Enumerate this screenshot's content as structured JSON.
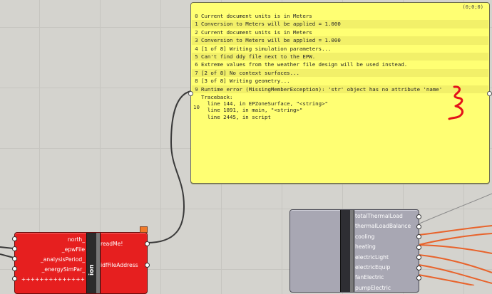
{
  "panel": {
    "coordinate": "(0;0;0)",
    "lines": [
      {
        "num": "0",
        "text": "Current document units is in Meters"
      },
      {
        "num": "1",
        "text": "Conversion to Meters will be applied = 1.000"
      },
      {
        "num": "2",
        "text": "Current document units is in Meters"
      },
      {
        "num": "3",
        "text": "Conversion to Meters will be applied = 1.000"
      },
      {
        "num": "4",
        "text": "[1 of 8] Writing simulation parameters..."
      },
      {
        "num": "5",
        "text": "Can't find ddy file next to the EPW."
      },
      {
        "num": "6",
        "text": "Extreme values from the weather file design will be used instead."
      },
      {
        "num": "7",
        "text": "[2 of 8] No context surfaces..."
      },
      {
        "num": "8",
        "text": "[3 of 8] Writing geometry..."
      },
      {
        "num": "9",
        "text": "Runtime error (MissingMemberException): 'str' object has no attribute 'name'"
      }
    ],
    "traceback": {
      "num": "10",
      "lines": [
        "Traceback:",
        "  line 144, in EPZoneSurface, \"<string>\"",
        "  line 1891, in main, \"<string>\"",
        "  line 2445, in script"
      ]
    }
  },
  "red_component": {
    "inputs": [
      "north_",
      "_epwFile",
      "_analysisPeriod_",
      "_energySimPar_",
      "++++++++++++++"
    ],
    "outputs": [
      "readMe!",
      "idfFileAddress"
    ],
    "vertical_label": "ion"
  },
  "gray_component": {
    "outputs": [
      "totalThermalLoad",
      "thermalLoadBalance",
      "cooling",
      "heating",
      "electricLight",
      "electricEquip",
      "fanElectric",
      "pumpElectric"
    ]
  },
  "colors": {
    "panel_bg": "#ffff73",
    "red_component": "#e61f1f",
    "gray_component": "#a8a7b3",
    "wire_orange": "#e8632b",
    "scribble_red": "#e3121a"
  }
}
